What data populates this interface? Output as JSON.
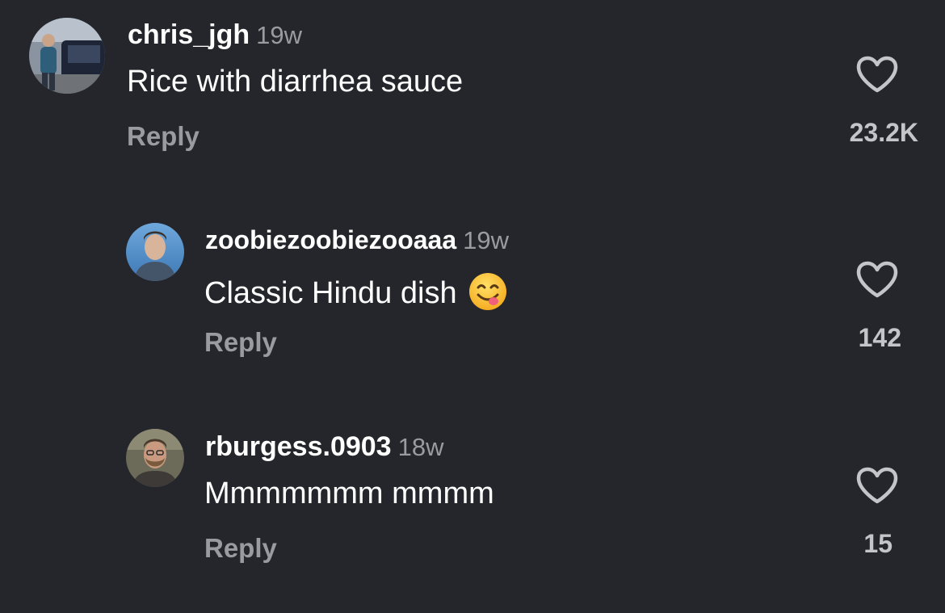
{
  "comments": [
    {
      "username": "chris_jgh",
      "time": "19w",
      "text": "Rice with diarrhea sauce",
      "reply_label": "Reply",
      "like_count": "23.2K",
      "avatar": "man-beside-car-avatar"
    },
    {
      "username": "zoobiezoobiezooaaa",
      "time": "19w",
      "text": "Classic Hindu dish",
      "emoji": "face-savoring-food-emoji",
      "reply_label": "Reply",
      "like_count": "142",
      "avatar": "portrait-blue-sky-avatar"
    },
    {
      "username": "rburgess.0903",
      "time": "18w",
      "text": "Mmmmmmm mmmm",
      "reply_label": "Reply",
      "like_count": "15",
      "avatar": "bearded-man-avatar"
    }
  ],
  "colors": {
    "background": "#25262b",
    "primary_text": "#ffffff",
    "secondary_text": "#9a9ba0",
    "count_text": "#c4c5c9"
  }
}
